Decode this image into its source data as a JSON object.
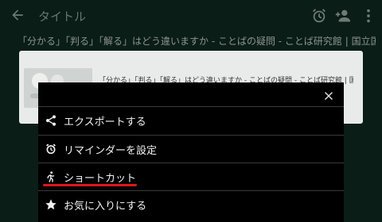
{
  "header": {
    "title": "タイトル",
    "icons": [
      "back-arrow-icon",
      "alarm-icon",
      "add-person-icon",
      "more-vert-icon"
    ]
  },
  "page": {
    "title": "「分かる」「判る」「解る」はどう違いますか - ことばの疑問 - ことば研究館 | 国立国語研究所"
  },
  "card": {
    "title": "「分かる」「判る」「解る」はどう違いますか - ことばの疑問 - ことば研究館 | 国...",
    "subtitle": "..."
  },
  "menu": {
    "items": [
      {
        "label": "エクスポートする",
        "icon": "share-icon"
      },
      {
        "label": "リマインダーを設定",
        "icon": "alarm-icon"
      },
      {
        "label": "ショートカット",
        "icon": "shortcut-icon"
      },
      {
        "label": "お気に入りにする",
        "icon": "star-icon"
      }
    ]
  },
  "colors": {
    "background": "#0a1d16",
    "sheet": "#000000",
    "highlight": "#e0151b"
  }
}
